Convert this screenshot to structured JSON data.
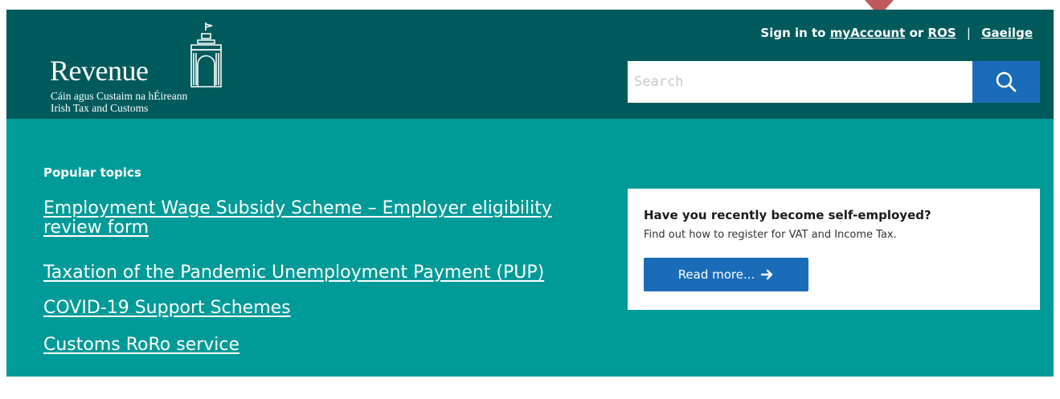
{
  "header": {
    "logo": {
      "word": "Revenue",
      "subtitle_irish": "Cáin agus Custaim na hÉireann",
      "subtitle_english": "Irish Tax and Customs"
    },
    "signin": {
      "prefix": "Sign in to",
      "my_account": "myAccount",
      "or": "or",
      "ros": "ROS",
      "separator": "|",
      "gaeilge": "Gaeilge"
    },
    "search": {
      "placeholder": "Search",
      "button_icon": "search-icon"
    }
  },
  "main": {
    "popular_topics_heading": "Popular topics",
    "topics": [
      "Employment Wage Subsidy Scheme – Employer eligibility review form",
      "Taxation of the Pandemic Unemployment Payment (PUP)",
      "COVID-19 Support Schemes",
      "Customs RoRo service"
    ],
    "card": {
      "title": "Have you recently become self-employed?",
      "text": "Find out how to register for VAT and Income Tax.",
      "button_label": "Read more...",
      "button_icon": "arrow-right-icon"
    }
  },
  "colors": {
    "header_bg": "#005a5c",
    "main_bg": "#009b98",
    "accent_blue": "#1a6cb8",
    "pointer": "#c0595a"
  }
}
